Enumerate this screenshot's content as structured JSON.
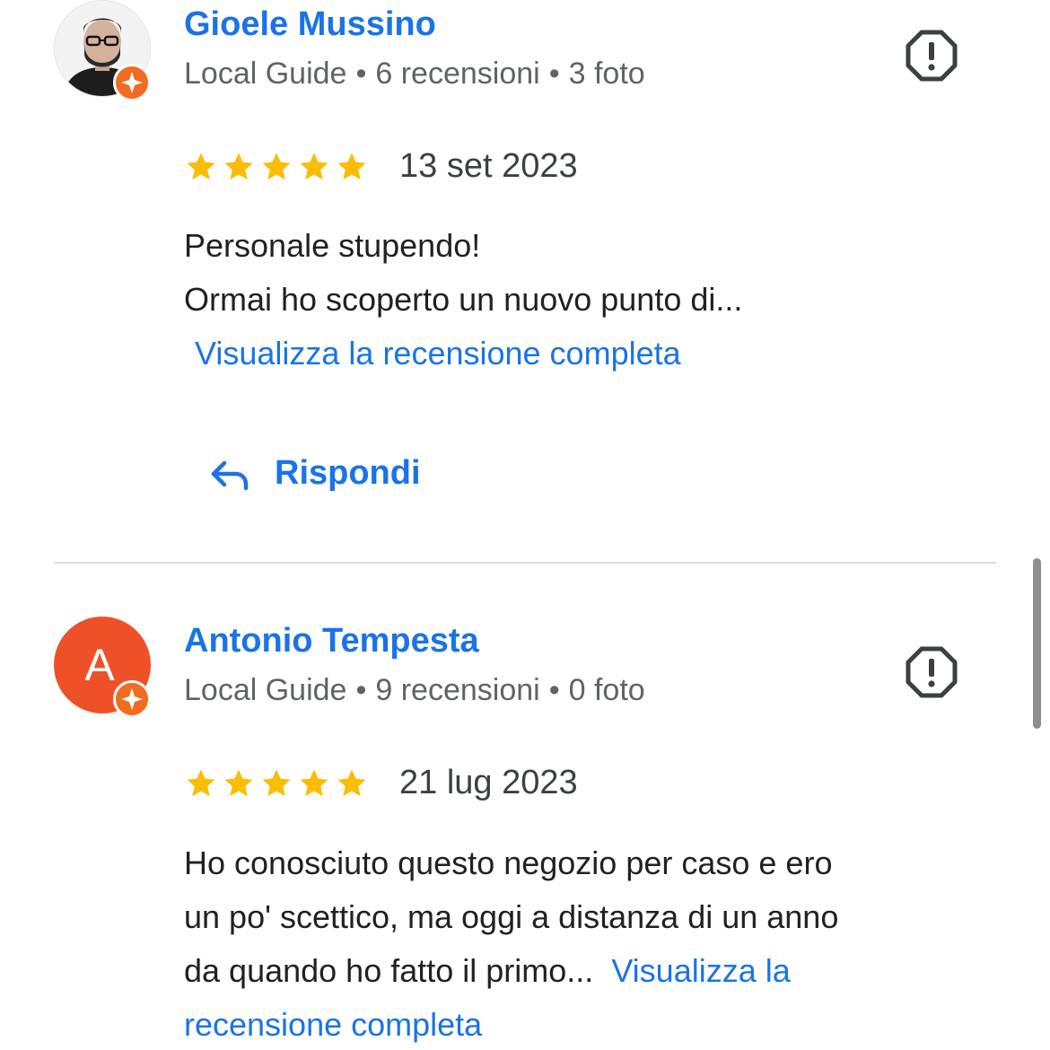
{
  "reviews": [
    {
      "name": "Gioele Mussino",
      "avatar_type": "photo",
      "guide_label": "Local Guide",
      "reviews_count": "6 recensioni",
      "photos_count": "3 foto",
      "separator": "•",
      "rating": 5,
      "date": "13 set 2023",
      "text_lines": [
        "Personale stupendo!",
        "Ormai ho scoperto un nuovo punto di..."
      ],
      "more_link": "Visualizza la recensione completa",
      "reply_label": "Rispondi"
    },
    {
      "name": "Antonio Tempesta",
      "avatar_type": "letter",
      "avatar_letter": "A",
      "avatar_color": "#ee5127",
      "guide_label": "Local Guide",
      "reviews_count": "9 recensioni",
      "photos_count": "0 foto",
      "separator": "•",
      "rating": 5,
      "date": "21 lug 2023",
      "text_lines": [
        "Ho conosciuto questo negozio per caso e ero",
        "un po' scettico, ma oggi a distanza di un anno",
        "da quando ho fatto il primo..."
      ],
      "more_link_part1": "Visualizza la",
      "more_link_part2": "recensione completa"
    }
  ],
  "icons": {
    "report": "report-icon",
    "star": "star-icon",
    "reply": "reply-arrow-icon",
    "guide_badge": "local-guide-badge-icon"
  },
  "colors": {
    "link": "#1a73e8",
    "star": "#fbbc04",
    "guide_badge": "#f26b21",
    "divider": "#dadce0"
  }
}
